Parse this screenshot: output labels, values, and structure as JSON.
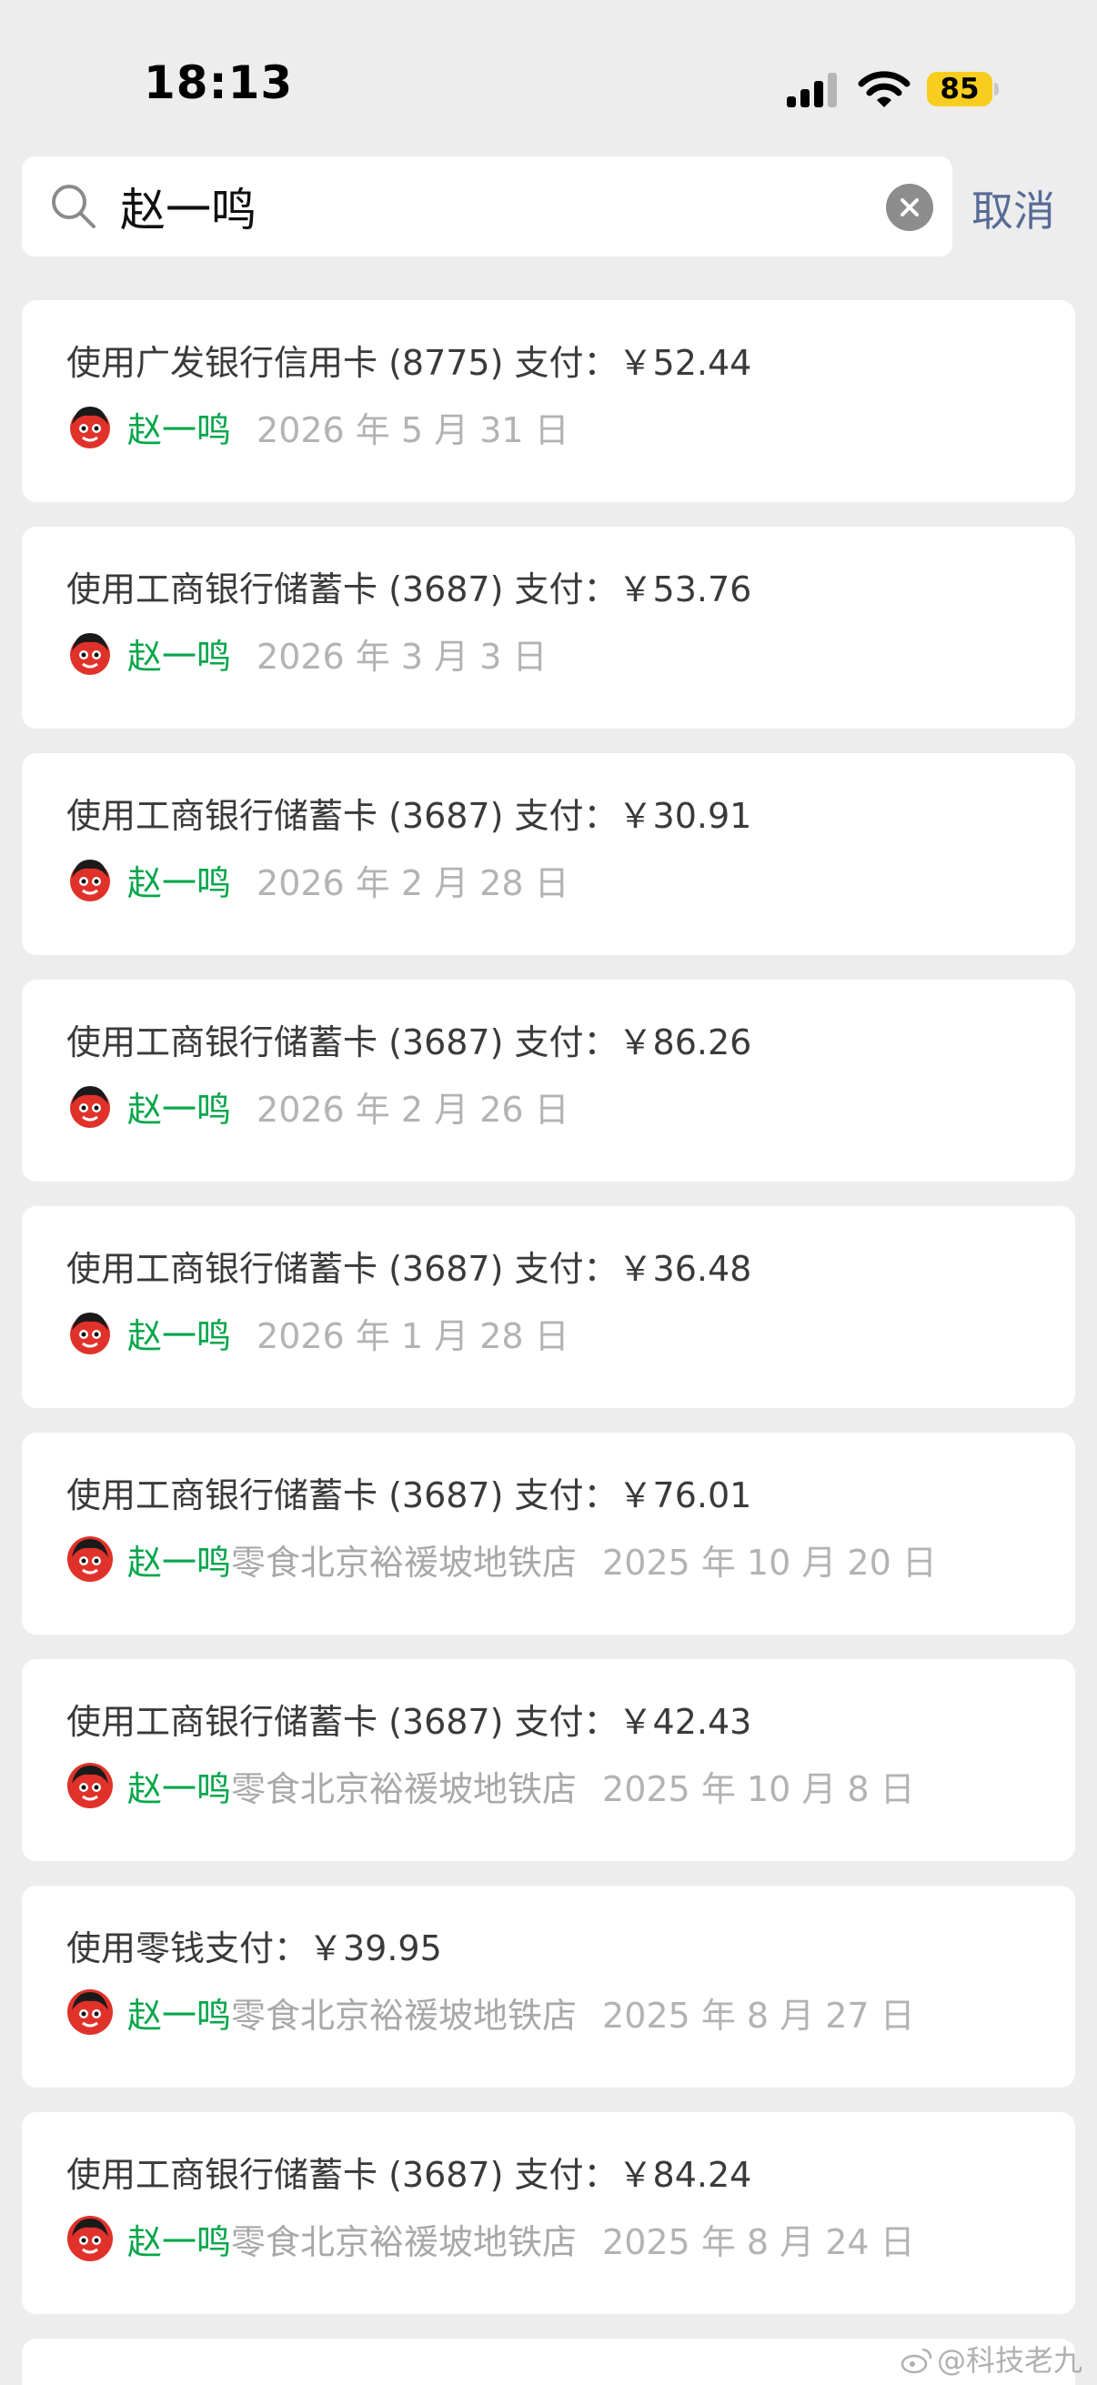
{
  "status_bar": {
    "time": "18:13",
    "battery": "85",
    "battery_color": "#f7ce1f"
  },
  "search": {
    "value": "赵一鸣",
    "cancel_label": "取消"
  },
  "colors": {
    "name_green": "#07a64b",
    "cancel_blue": "#576b95"
  },
  "transactions": [
    {
      "payment": "使用广发银行信用卡 (8775) 支付：￥52.44",
      "name": "赵一鸣",
      "store": "",
      "date": "2026 年 5 月 31 日"
    },
    {
      "payment": "使用工商银行储蓄卡 (3687) 支付：￥53.76",
      "name": "赵一鸣",
      "store": "",
      "date": "2026 年 3 月 3 日"
    },
    {
      "payment": "使用工商银行储蓄卡 (3687) 支付：￥30.91",
      "name": "赵一鸣",
      "store": "",
      "date": "2026 年 2 月 28 日"
    },
    {
      "payment": "使用工商银行储蓄卡 (3687) 支付：￥86.26",
      "name": "赵一鸣",
      "store": "",
      "date": "2026 年 2 月 26 日"
    },
    {
      "payment": "使用工商银行储蓄卡 (3687) 支付：￥36.48",
      "name": "赵一鸣",
      "store": "",
      "date": "2026 年 1 月 28 日"
    },
    {
      "payment": "使用工商银行储蓄卡 (3687) 支付：￥76.01",
      "name": "赵一鸣",
      "store": "零食北京裕禐坡地铁店",
      "date": "2025 年 10 月 20 日"
    },
    {
      "payment": "使用工商银行储蓄卡 (3687) 支付：￥42.43",
      "name": "赵一鸣",
      "store": "零食北京裕禐坡地铁店",
      "date": "2025 年 10 月 8 日"
    },
    {
      "payment": "使用零钱支付：￥39.95",
      "name": "赵一鸣",
      "store": "零食北京裕禐坡地铁店",
      "date": "2025 年 8 月 27 日"
    },
    {
      "payment": "使用工商银行储蓄卡 (3687) 支付：￥84.24",
      "name": "赵一鸣",
      "store": "零食北京裕禐坡地铁店",
      "date": "2025 年 8 月 24 日"
    }
  ],
  "watermark": "@科技老九"
}
